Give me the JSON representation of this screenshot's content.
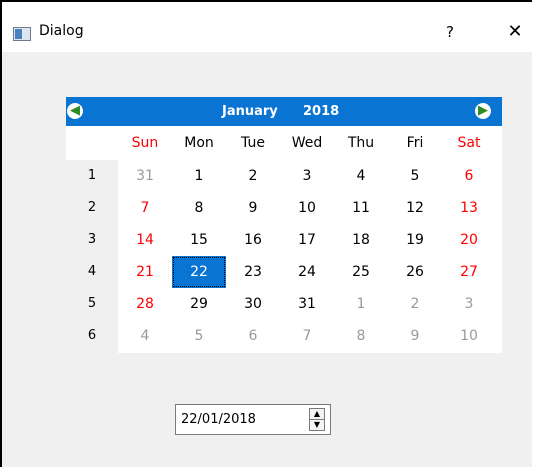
{
  "window": {
    "title": "Dialog",
    "help_label": "?",
    "close_label": "✕"
  },
  "calendar": {
    "month": "January",
    "year": "2018",
    "prev_icon": "◀",
    "next_icon": "▶",
    "day_headers": [
      {
        "label": "Sun",
        "weekend": true
      },
      {
        "label": "Mon",
        "weekend": false
      },
      {
        "label": "Tue",
        "weekend": false
      },
      {
        "label": "Wed",
        "weekend": false
      },
      {
        "label": "Thu",
        "weekend": false
      },
      {
        "label": "Fri",
        "weekend": false
      },
      {
        "label": "Sat",
        "weekend": true
      }
    ],
    "weeks": [
      {
        "week": "1",
        "days": [
          {
            "d": "31",
            "s": "dim"
          },
          {
            "d": "1",
            "s": ""
          },
          {
            "d": "2",
            "s": ""
          },
          {
            "d": "3",
            "s": ""
          },
          {
            "d": "4",
            "s": ""
          },
          {
            "d": "5",
            "s": ""
          },
          {
            "d": "6",
            "s": "red"
          }
        ]
      },
      {
        "week": "2",
        "days": [
          {
            "d": "7",
            "s": "red"
          },
          {
            "d": "8",
            "s": ""
          },
          {
            "d": "9",
            "s": ""
          },
          {
            "d": "10",
            "s": ""
          },
          {
            "d": "11",
            "s": ""
          },
          {
            "d": "12",
            "s": ""
          },
          {
            "d": "13",
            "s": "red"
          }
        ]
      },
      {
        "week": "3",
        "days": [
          {
            "d": "14",
            "s": "red"
          },
          {
            "d": "15",
            "s": ""
          },
          {
            "d": "16",
            "s": ""
          },
          {
            "d": "17",
            "s": ""
          },
          {
            "d": "18",
            "s": ""
          },
          {
            "d": "19",
            "s": ""
          },
          {
            "d": "20",
            "s": "red"
          }
        ]
      },
      {
        "week": "4",
        "days": [
          {
            "d": "21",
            "s": "red"
          },
          {
            "d": "22",
            "s": "selected"
          },
          {
            "d": "23",
            "s": ""
          },
          {
            "d": "24",
            "s": ""
          },
          {
            "d": "25",
            "s": ""
          },
          {
            "d": "26",
            "s": ""
          },
          {
            "d": "27",
            "s": "red"
          }
        ]
      },
      {
        "week": "5",
        "days": [
          {
            "d": "28",
            "s": "red"
          },
          {
            "d": "29",
            "s": ""
          },
          {
            "d": "30",
            "s": ""
          },
          {
            "d": "31",
            "s": ""
          },
          {
            "d": "1",
            "s": "dim"
          },
          {
            "d": "2",
            "s": "dim"
          },
          {
            "d": "3",
            "s": "dim"
          }
        ]
      },
      {
        "week": "6",
        "days": [
          {
            "d": "4",
            "s": "dim"
          },
          {
            "d": "5",
            "s": "dim"
          },
          {
            "d": "6",
            "s": "dim"
          },
          {
            "d": "7",
            "s": "dim"
          },
          {
            "d": "8",
            "s": "dim"
          },
          {
            "d": "9",
            "s": "dim"
          },
          {
            "d": "10",
            "s": "dim"
          }
        ]
      }
    ],
    "colors": {
      "nav_bar": "#0a74d2",
      "weekend": "#ff0000",
      "dim": "#9a9a9a",
      "selected_bg": "#0a74d2"
    }
  },
  "date_edit": {
    "value": "22/01/2018",
    "up_icon": "▲",
    "down_icon": "▼"
  }
}
